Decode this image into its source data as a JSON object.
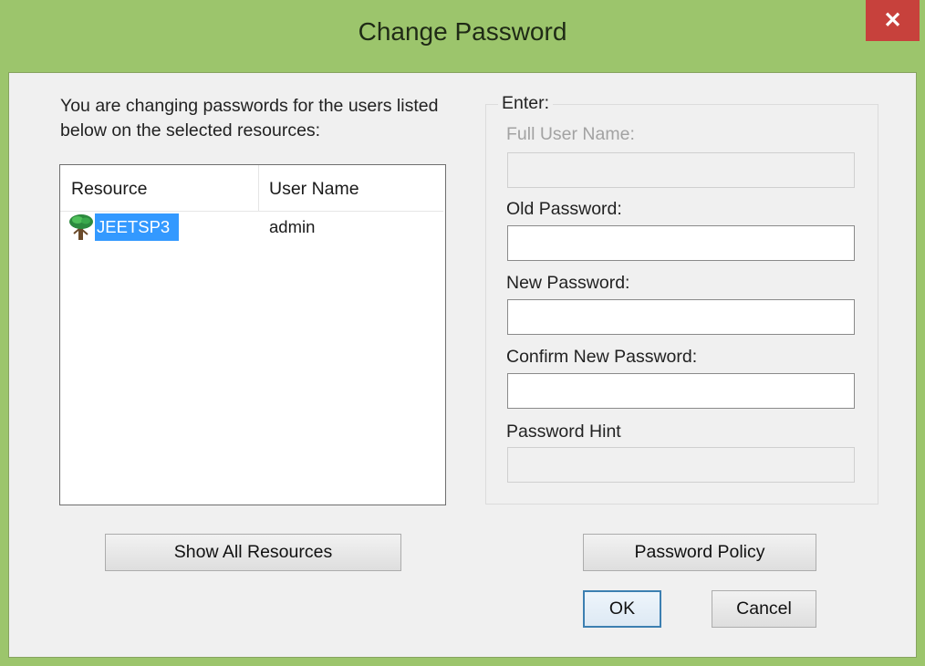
{
  "window": {
    "title": "Change Password",
    "close_glyph": "✕"
  },
  "intro": {
    "text": "You are changing passwords for the users listed below on the selected resources:"
  },
  "list": {
    "columns": [
      "Resource",
      "User Name"
    ],
    "rows": [
      {
        "resource": "JEETSP3",
        "user_name": "admin",
        "icon": "tree-icon",
        "selected": true
      }
    ]
  },
  "enter_group": {
    "legend": "Enter:",
    "full_user_name_label": "Full User Name:",
    "full_user_name_value": "",
    "old_password_label": "Old Password:",
    "old_password_value": "",
    "new_password_label": "New Password:",
    "new_password_value": "",
    "confirm_password_label": "Confirm New Password:",
    "confirm_password_value": "",
    "password_hint_label": "Password Hint",
    "password_hint_value": ""
  },
  "buttons": {
    "show_all_resources": "Show All Resources",
    "password_policy": "Password Policy",
    "ok": "OK",
    "cancel": "Cancel"
  },
  "colors": {
    "title_bar": "#9cc56c",
    "close_button": "#c7413c",
    "selection": "#3399ff",
    "dialog_background": "#f0f0f0"
  }
}
